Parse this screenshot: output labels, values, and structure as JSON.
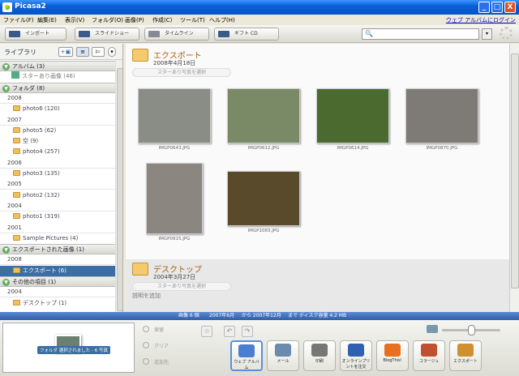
{
  "window": {
    "title": "Picasa2",
    "controls": {
      "minimize": "_",
      "maximize": "□",
      "close": "X"
    }
  },
  "menu": {
    "items": [
      "ファイル(F)",
      "編集(E)",
      "表示(V)",
      "フォルダ(O)",
      "画像(P)",
      "作成(C)",
      "ツール(T)",
      "ヘルプ(H)"
    ],
    "web_link": "ウェブ アルバムにログイン"
  },
  "toolbar": {
    "import": "インポート",
    "slideshow": "スライドショー",
    "timeline": "タイムライン",
    "giftcd": "ギフト CD",
    "search_placeholder": ""
  },
  "library": {
    "title": "ライブラリ",
    "rows": [
      {
        "type": "sec",
        "label": "アルバム (3)"
      },
      {
        "type": "stars",
        "label": "スターあり画像 (46)"
      },
      {
        "type": "sec",
        "label": "フォルダ (8)"
      },
      {
        "type": "yr",
        "label": "2008"
      },
      {
        "type": "item",
        "label": "photo6 (120)"
      },
      {
        "type": "yr",
        "label": "2007"
      },
      {
        "type": "item",
        "label": "photo5 (62)"
      },
      {
        "type": "item",
        "label": "空 (9)"
      },
      {
        "type": "item",
        "label": "photo4 (257)"
      },
      {
        "type": "yr",
        "label": "2006"
      },
      {
        "type": "item",
        "label": "photo3 (135)"
      },
      {
        "type": "yr",
        "label": "2005"
      },
      {
        "type": "item",
        "label": "photo2 (132)"
      },
      {
        "type": "yr",
        "label": "2004"
      },
      {
        "type": "item",
        "label": "photo1 (319)"
      },
      {
        "type": "yr",
        "label": "2001"
      },
      {
        "type": "item",
        "label": "Sample Pictures (4)"
      },
      {
        "type": "sec",
        "label": "エクスポートされた画像 (1)"
      },
      {
        "type": "yr",
        "label": "2008"
      },
      {
        "type": "item sel",
        "label": "エクスポート (6)"
      },
      {
        "type": "sec",
        "label": "その他の項目 (1)"
      },
      {
        "type": "yr",
        "label": "2004"
      },
      {
        "type": "item",
        "label": "デスクトップ (1)"
      }
    ]
  },
  "folder1": {
    "title": "エクスポート",
    "date": "2008年4月18日",
    "stars": "スターあり写真を選択",
    "photos": [
      {
        "cap": "IMGP0643.JPG",
        "bg": "#8a8d86"
      },
      {
        "cap": "IMGP0612.JPG",
        "bg": "#7a8a66"
      },
      {
        "cap": "IMGP0614.JPG",
        "bg": "#4a6a30"
      },
      {
        "cap": "IMGP0870.JPG",
        "bg": "#7e7a76"
      },
      {
        "cap": "IMGP0915.JPG",
        "bg": "#8b8780"
      },
      {
        "cap": "IMGP1083.JPG",
        "bg": "#5a4a2c"
      }
    ]
  },
  "folder2": {
    "title": "デスクトップ",
    "date": "2004年3月27日",
    "stars": "スターあり写真を選択",
    "add_caption": "説明を追加"
  },
  "status": {
    "count": "画像 6 個",
    "from": "2007年6月",
    "mid": "から 2007年12月",
    "disk": "まで ディスク容量 4.2 MB"
  },
  "tray": {
    "label": "フォルダ 選択されました - 6 写真",
    "hold": "保留",
    "clear": "クリア",
    "add": "追加先"
  },
  "actions": [
    {
      "label": "ウェブ アルバム",
      "color": "#4a7fd0"
    },
    {
      "label": "メール",
      "color": "#6a8ab0"
    },
    {
      "label": "印刷",
      "color": "#777"
    },
    {
      "label": "オンラインプリントを注文",
      "color": "#3060b0"
    },
    {
      "label": "BlogThis!",
      "color": "#e87020"
    },
    {
      "label": "コラージュ",
      "color": "#c05030"
    },
    {
      "label": "エクスポート",
      "color": "#d09030"
    }
  ]
}
